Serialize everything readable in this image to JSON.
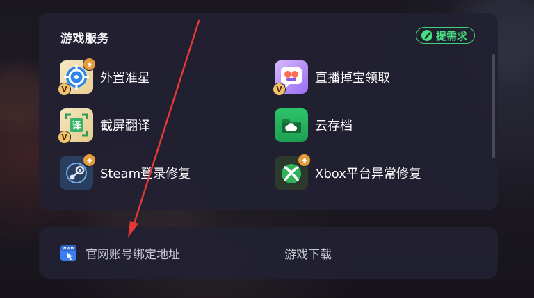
{
  "panel": {
    "title": "游戏服务",
    "request_button": "提需求"
  },
  "services": [
    {
      "label": "外置准星",
      "icon": "crosshair-icon",
      "has_update_badge": true,
      "has_vip_badge": true
    },
    {
      "label": "直播掉宝领取",
      "icon": "live-drop-icon",
      "has_update_badge": false,
      "has_vip_badge": true
    },
    {
      "label": "截屏翻译",
      "icon": "screenshot-translate-icon",
      "has_update_badge": false,
      "has_vip_badge": true
    },
    {
      "label": "云存档",
      "icon": "cloud-save-icon",
      "has_update_badge": false,
      "has_vip_badge": false
    },
    {
      "label": "Steam登录修复",
      "icon": "steam-icon",
      "has_update_badge": true,
      "has_vip_badge": false
    },
    {
      "label": "Xbox平台异常修复",
      "icon": "xbox-icon",
      "has_update_badge": true,
      "has_vip_badge": false
    }
  ],
  "links": {
    "bind_address": "官网账号绑定地址",
    "game_download": "游戏下载"
  },
  "colors": {
    "accent_green": "#46e082",
    "annotation_red": "#e53935",
    "update_badge": "#e59c3b"
  },
  "annotation": {
    "type": "red-arrow",
    "points_to": "官网账号绑定地址"
  }
}
